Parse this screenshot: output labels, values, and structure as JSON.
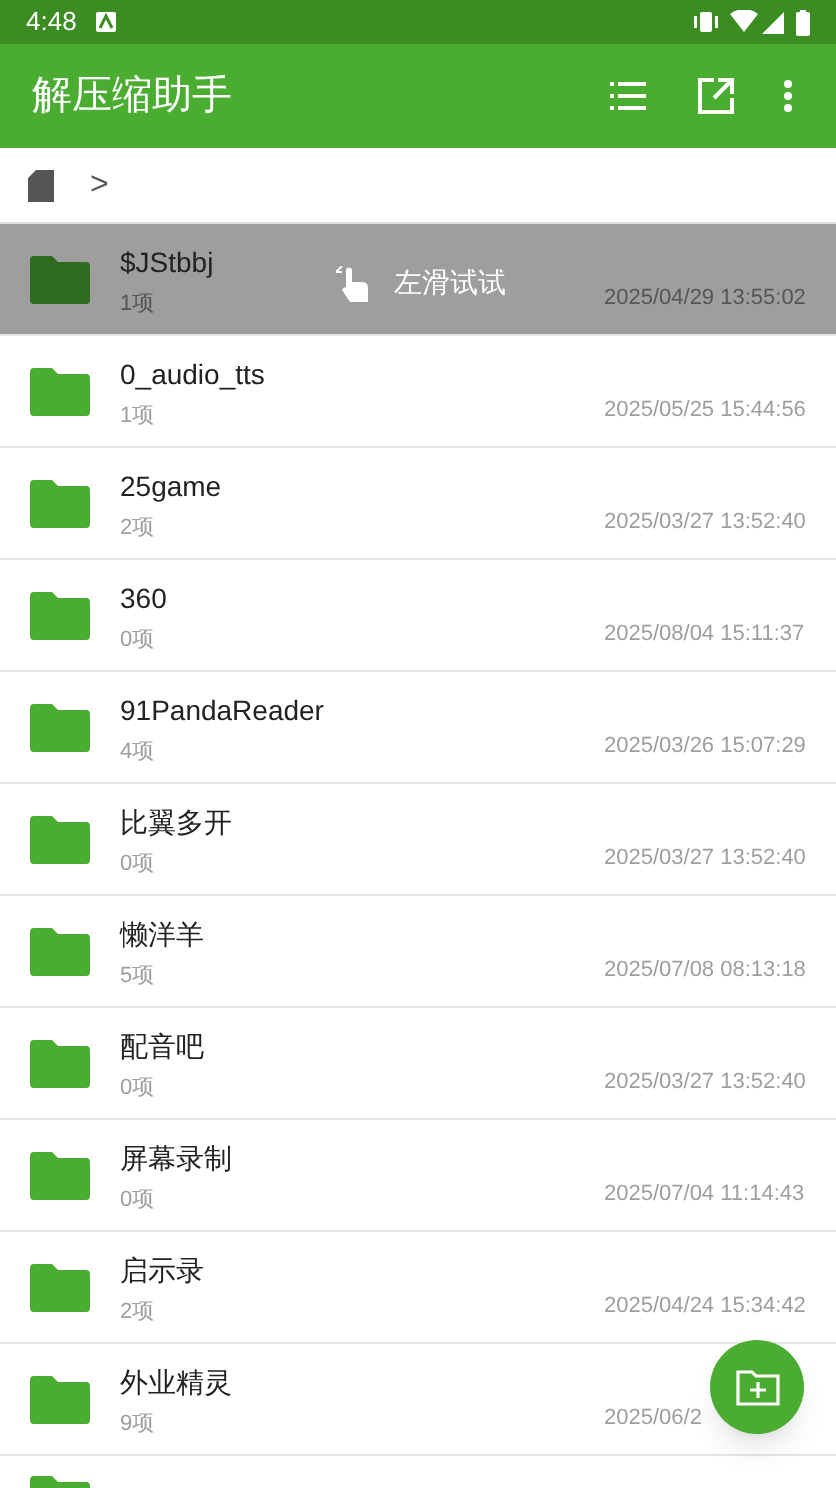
{
  "status_bar": {
    "time": "4:48"
  },
  "app_bar": {
    "title": "解压缩助手"
  },
  "breadcrumb": {
    "separator": ">"
  },
  "swipe_hint": {
    "text": "左滑试试"
  },
  "files": [
    {
      "name": "$JStbbj",
      "count": "1项",
      "date": "2025/04/29 13:55:02",
      "selected": true
    },
    {
      "name": "0_audio_tts",
      "count": "1项",
      "date": "2025/05/25 15:44:56",
      "selected": false
    },
    {
      "name": "25game",
      "count": "2项",
      "date": "2025/03/27 13:52:40",
      "selected": false
    },
    {
      "name": "360",
      "count": "0项",
      "date": "2025/08/04 15:11:37",
      "selected": false
    },
    {
      "name": "91PandaReader",
      "count": "4项",
      "date": "2025/03/26 15:07:29",
      "selected": false
    },
    {
      "name": "比翼多开",
      "count": "0项",
      "date": "2025/03/27 13:52:40",
      "selected": false
    },
    {
      "name": "懒洋羊",
      "count": "5项",
      "date": "2025/07/08 08:13:18",
      "selected": false
    },
    {
      "name": "配音吧",
      "count": "0项",
      "date": "2025/03/27 13:52:40",
      "selected": false
    },
    {
      "name": "屏幕录制",
      "count": "0项",
      "date": "2025/07/04 11:14:43",
      "selected": false
    },
    {
      "name": "启示录",
      "count": "2项",
      "date": "2025/04/24 15:34:42",
      "selected": false
    },
    {
      "name": "外业精灵",
      "count": "9项",
      "date": "2025/06/2",
      "selected": false
    }
  ]
}
